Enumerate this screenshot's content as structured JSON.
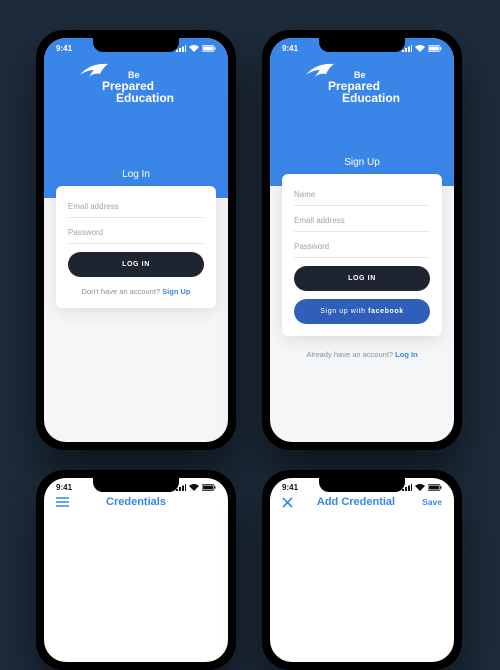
{
  "colors": {
    "brand_blue": "#3a86e8",
    "dark": "#1e2430",
    "bg": "#1d2b3a",
    "fb_blue": "#2f5fb8"
  },
  "status": {
    "time": "9:41"
  },
  "brand": {
    "line1": "Be",
    "line2": "Prepared",
    "line3": "Education"
  },
  "login": {
    "heading": "Log In",
    "email_placeholder": "Email address",
    "password_placeholder": "Password",
    "submit_label": "LOG IN",
    "alt_prompt": "Don't have an account? ",
    "alt_action": "Sign Up"
  },
  "signup": {
    "heading": "Sign Up",
    "name_placeholder": "Name",
    "email_placeholder": "Email address",
    "password_placeholder": "Password",
    "submit_label": "LOG IN",
    "fb_prefix": "Sign up with ",
    "fb_brand": "facebook",
    "alt_prompt": "Already have an account? ",
    "alt_action": "Log In"
  },
  "peek_left": {
    "title": "Credentials"
  },
  "peek_right": {
    "title": "Add Credential",
    "save": "Save"
  }
}
